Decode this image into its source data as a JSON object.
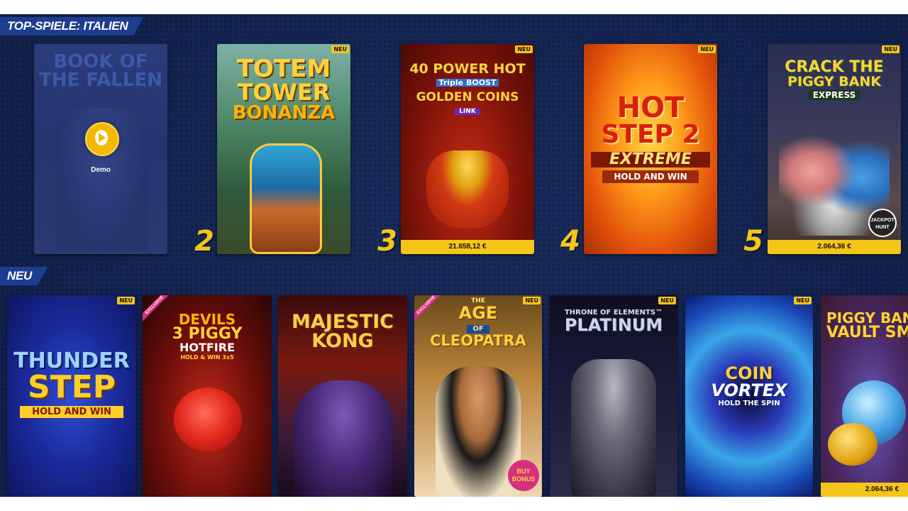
{
  "sections": {
    "top": {
      "title": "TOP-SPIELE: ITALIEN"
    },
    "new": {
      "title": "NEU"
    }
  },
  "demo": {
    "label": "Demo",
    "play_icon": "play-icon"
  },
  "badges": {
    "new": "NEU",
    "exclusive": "EXCLUSIVE"
  },
  "top_games": [
    {
      "rank": "",
      "title_lines": [
        "BOOK OF",
        "THE FALLEN"
      ]
    },
    {
      "rank": "2",
      "title_lines": [
        "TOTEM",
        "TOWER",
        "BONANZA"
      ]
    },
    {
      "rank": "3",
      "title_lines": [
        "40 POWER HOT",
        "Triple BOOST",
        "GOLDEN COINS",
        "LINK"
      ],
      "jackpot": "21.658,12 €"
    },
    {
      "rank": "4",
      "title_lines": [
        "HOT",
        "STEP 2",
        "EXTREME",
        "HOLD AND WIN"
      ]
    },
    {
      "rank": "5",
      "title_lines": [
        "CRACK THE",
        "PIGGY BANK",
        "EXPRESS",
        "JACKPOT HUNT"
      ],
      "jackpot": "2.064,36 €"
    }
  ],
  "new_games": [
    {
      "title_lines": [
        "THUNDER",
        "STEP",
        "HOLD AND WIN"
      ]
    },
    {
      "title_lines": [
        "DEVILS",
        "3 PIGGY",
        "HOTFIRE",
        "HOLD & WIN 3x5"
      ]
    },
    {
      "title_lines": [
        "MAJESTIC",
        "KONG"
      ]
    },
    {
      "title_lines": [
        "THE",
        "AGE",
        "OF",
        "CLEOPATRA",
        "BUY BONUS"
      ]
    },
    {
      "title_lines": [
        "THRONE OF ELEMENTS™",
        "PLATINUM"
      ]
    },
    {
      "title_lines": [
        "COIN",
        "VORTEX",
        "HOLD THE SPIN"
      ]
    },
    {
      "title_lines": [
        "PIGGY BANK",
        "VAULT SMA"
      ],
      "jackpot": "2.064,36 €"
    }
  ],
  "colors": {
    "accent": "#f5c518",
    "background": "#13224d",
    "section_banner": "#1d3d8f"
  }
}
